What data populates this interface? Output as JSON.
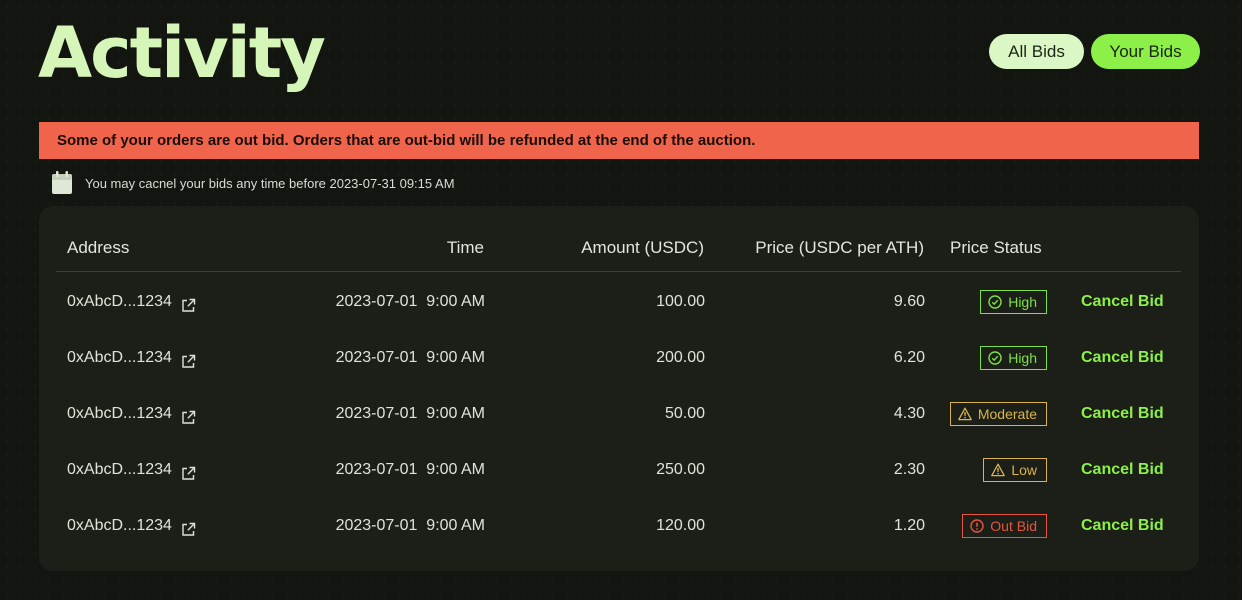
{
  "page": {
    "title": "Activity"
  },
  "toggle": {
    "all_bids": "All Bids",
    "your_bids": "Your Bids"
  },
  "alert": {
    "text": "Some of your orders are out bid. Orders that are out-bid will be refunded at the end of the auction."
  },
  "notice": {
    "text": "You may cacnel your bids any time before 2023-07-31 09:15 AM"
  },
  "table": {
    "headers": {
      "address": "Address",
      "time": "Time",
      "amount": "Amount (USDC)",
      "price": "Price (USDC per ATH)",
      "status": "Price Status"
    },
    "rows": [
      {
        "address": "0xAbcD...1234",
        "time": "2023-07-01  9:00 AM",
        "amount": "100.00",
        "price": "9.60",
        "status": "High",
        "status_kind": "high",
        "action": "Cancel Bid"
      },
      {
        "address": "0xAbcD...1234",
        "time": "2023-07-01  9:00 AM",
        "amount": "200.00",
        "price": "6.20",
        "status": "High",
        "status_kind": "high",
        "action": "Cancel Bid"
      },
      {
        "address": "0xAbcD...1234",
        "time": "2023-07-01  9:00 AM",
        "amount": "50.00",
        "price": "4.30",
        "status": "Moderate",
        "status_kind": "moderate",
        "action": "Cancel Bid"
      },
      {
        "address": "0xAbcD...1234",
        "time": "2023-07-01  9:00 AM",
        "amount": "250.00",
        "price": "2.30",
        "status": "Low",
        "status_kind": "low",
        "action": "Cancel Bid"
      },
      {
        "address": "0xAbcD...1234",
        "time": "2023-07-01  9:00 AM",
        "amount": "120.00",
        "price": "1.20",
        "status": "Out Bid",
        "status_kind": "outbid",
        "action": "Cancel Bid"
      }
    ]
  },
  "colors": {
    "accent": "#8df048",
    "high": "#7fe046",
    "moderate": "#d8b44a",
    "low": "#d8b44a",
    "outbid": "#e8553e",
    "alert_bg": "#f0644c"
  },
  "icons": {
    "notice": "calendar-icon",
    "address_link": "external-link-icon",
    "high": "check-circle-icon",
    "moderate": "warning-triangle-icon",
    "low": "warning-triangle-icon",
    "outbid": "exclamation-circle-icon"
  }
}
